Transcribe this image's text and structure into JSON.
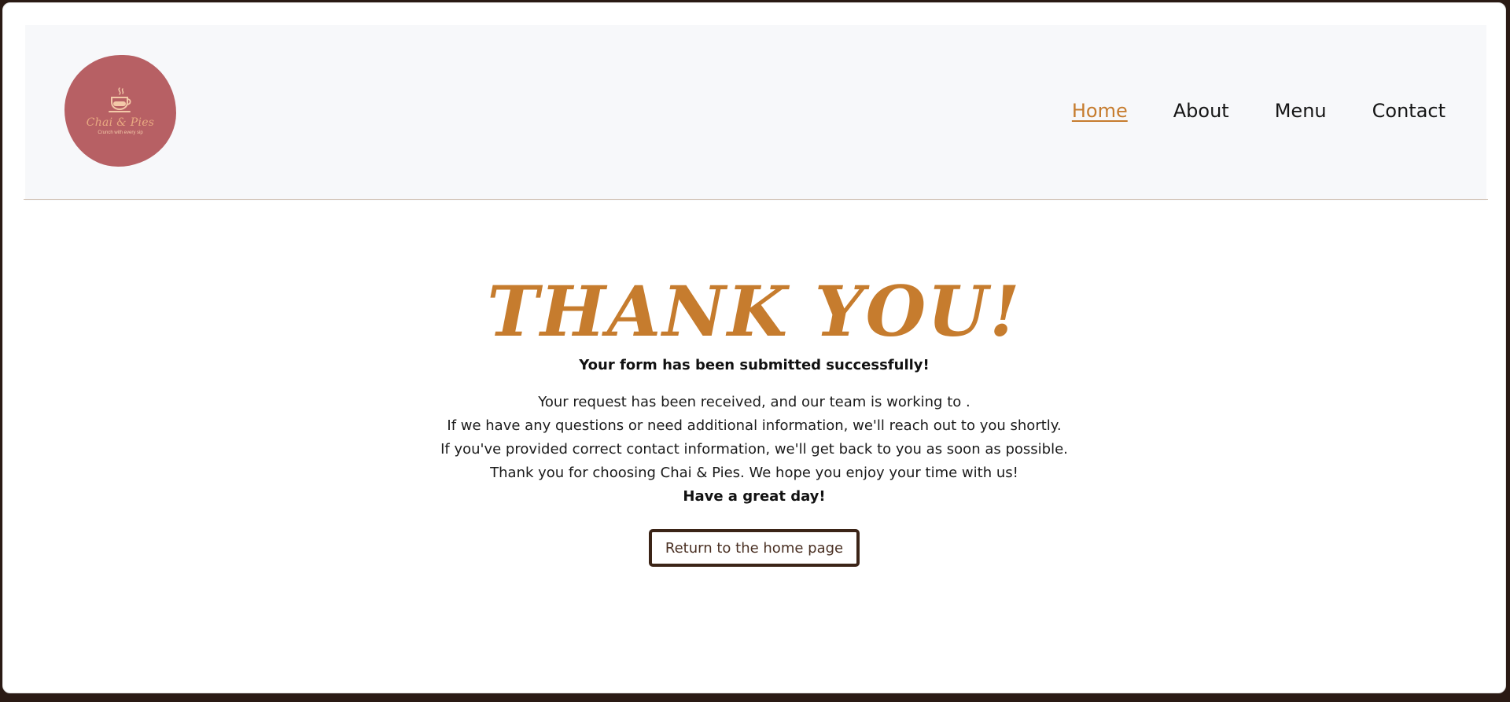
{
  "brand": {
    "name": "Chai & Pies",
    "tagline": "Crunch with every sip",
    "logo_color": "#b76064"
  },
  "nav": {
    "items": [
      {
        "label": "Home",
        "active": true
      },
      {
        "label": "About",
        "active": false
      },
      {
        "label": "Menu",
        "active": false
      },
      {
        "label": "Contact",
        "active": false
      }
    ]
  },
  "main": {
    "heading": "THANK YOU!",
    "subheading": "Your form has been submitted successfully!",
    "lines": [
      "Your request has been received, and our team is working to .",
      "If we have any questions or need additional information, we'll reach out to you shortly.",
      "If you've provided correct contact information, we'll get back to you as soon as possible.",
      "Thank you for choosing Chai & Pies. We hope you enjoy your time with us!"
    ],
    "closing": "Have a great day!",
    "button_label": "Return to the home page"
  },
  "colors": {
    "accent": "#c67c2e",
    "button_border": "#3b2417"
  }
}
